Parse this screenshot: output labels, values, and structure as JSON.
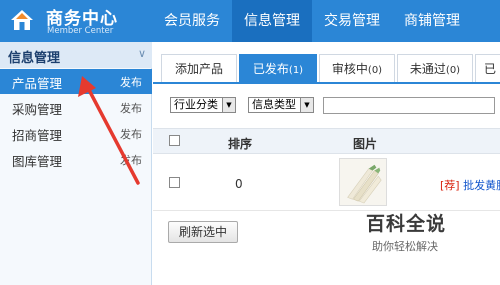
{
  "header": {
    "title": "商务中心",
    "subtitle": "Member Center",
    "nav": [
      {
        "label": "会员服务",
        "active": false
      },
      {
        "label": "信息管理",
        "active": true
      },
      {
        "label": "交易管理",
        "active": false
      },
      {
        "label": "商铺管理",
        "active": false
      },
      {
        "label": "网",
        "active": false
      }
    ]
  },
  "sidebar": {
    "section_title": "信息管理",
    "items": [
      {
        "label": "产品管理",
        "action": "发布",
        "active": true
      },
      {
        "label": "采购管理",
        "action": "发布",
        "active": false
      },
      {
        "label": "招商管理",
        "action": "发布",
        "active": false
      },
      {
        "label": "图库管理",
        "action": "发布",
        "active": false
      }
    ]
  },
  "main": {
    "tabs": [
      {
        "label": "添加产品",
        "count": "",
        "active": false
      },
      {
        "label": "已发布",
        "count": "(1)",
        "active": true
      },
      {
        "label": "审核中",
        "count": "(0)",
        "active": false
      },
      {
        "label": "未通过",
        "count": "(0)",
        "active": false
      },
      {
        "label": "已",
        "count": "",
        "active": false
      }
    ],
    "filters": {
      "industry": "行业分类",
      "info_type": "信息类型",
      "search_value": ""
    },
    "table": {
      "headers": {
        "sort": "排序",
        "image": "图片"
      },
      "rows": [
        {
          "sort": "0",
          "tag": "[荐]",
          "title": "批发黄腊"
        }
      ]
    },
    "refresh_button": "刷新选中"
  },
  "watermark": {
    "title": "百科全说",
    "subtitle": "助你轻松解决"
  },
  "colors": {
    "accent": "#2b86d6",
    "annotation": "#e53a2f"
  }
}
